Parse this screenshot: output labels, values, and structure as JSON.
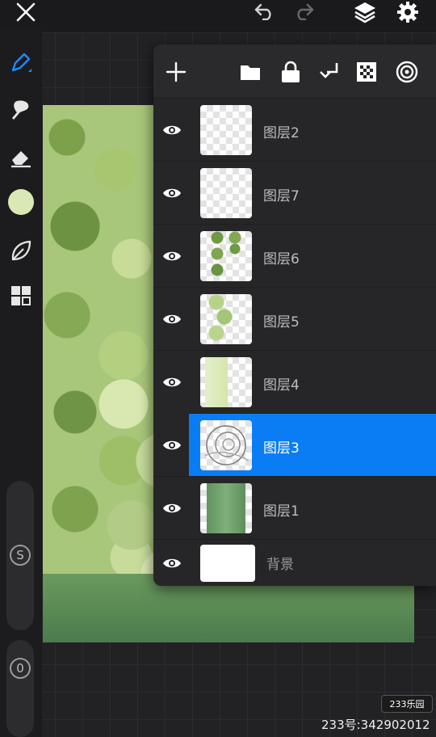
{
  "top_bar": {
    "close_icon": "close-icon",
    "undo_icon": "undo-icon",
    "redo_icon": "redo-icon",
    "layers_icon": "layers-icon",
    "settings_icon": "gear-icon"
  },
  "left_toolbar": {
    "tools": [
      "brush",
      "smudge",
      "eraser",
      "color",
      "leaf",
      "gallery"
    ],
    "brush_color": "#d9e8b4",
    "size_label": "S",
    "opacity_label": "0"
  },
  "layers_panel": {
    "header_icons": [
      "add",
      "folder",
      "lock",
      "merge-down",
      "checker",
      "reference"
    ],
    "layers": [
      {
        "name": "图层2",
        "visible": true,
        "selected": false
      },
      {
        "name": "图层7",
        "visible": true,
        "selected": false
      },
      {
        "name": "图层6",
        "visible": true,
        "selected": false
      },
      {
        "name": "图层5",
        "visible": true,
        "selected": false
      },
      {
        "name": "图层4",
        "visible": true,
        "selected": false
      },
      {
        "name": "图层3",
        "visible": true,
        "selected": true
      },
      {
        "name": "图层1",
        "visible": true,
        "selected": false
      },
      {
        "name": "背景",
        "visible": true,
        "selected": false
      }
    ]
  },
  "watermark": {
    "logo": "233乐园",
    "text": "233号:342902012"
  },
  "colors": {
    "accent": "#0a7df4",
    "panel_bg": "#262628"
  }
}
